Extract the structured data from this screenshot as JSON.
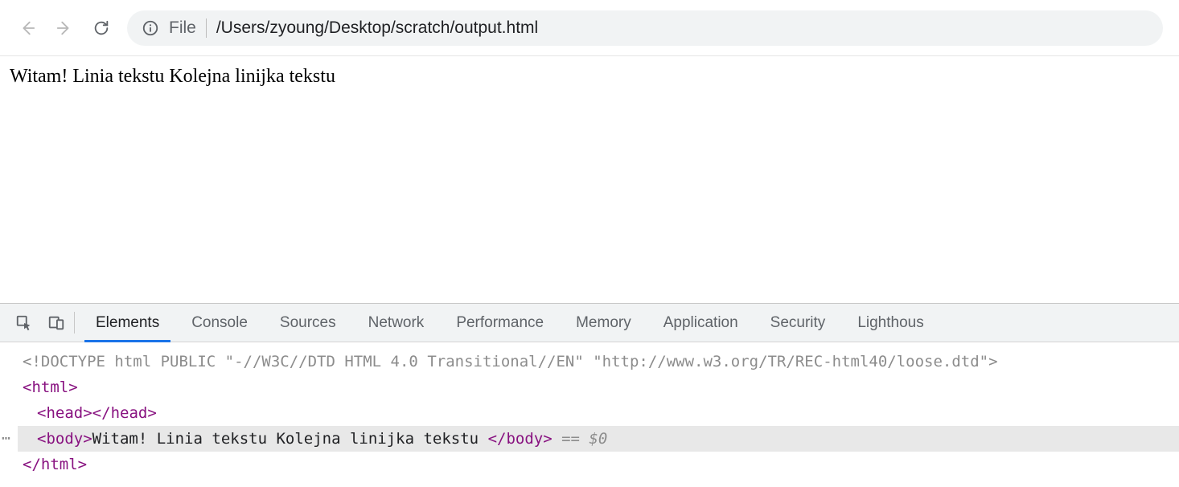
{
  "address_bar": {
    "scheme_label": "File",
    "path": "/Users/zyoung/Desktop/scratch/output.html"
  },
  "page": {
    "body_text": "Witam! Linia tekstu Kolejna linijka tekstu"
  },
  "devtools": {
    "tabs": [
      "Elements",
      "Console",
      "Sources",
      "Network",
      "Performance",
      "Memory",
      "Application",
      "Security",
      "Lighthous"
    ],
    "active_tab_index": 0,
    "dom": {
      "doctype": "<!DOCTYPE html PUBLIC \"-//W3C//DTD HTML 4.0 Transitional//EN\" \"http://www.w3.org/TR/REC-html40/loose.dtd\">",
      "html_open": "html",
      "head_open": "head",
      "head_close": "head",
      "body_open": "body",
      "body_text": "Witam! Linia tekstu Kolejna linijka tekstu ",
      "body_close": "body",
      "selected_suffix": " == $0",
      "html_close": "html"
    }
  }
}
